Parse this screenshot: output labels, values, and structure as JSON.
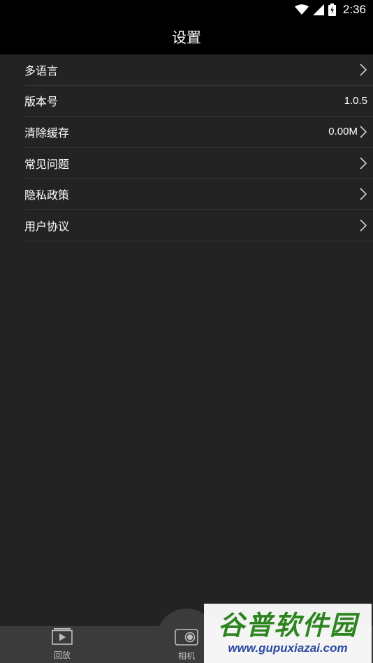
{
  "status_bar": {
    "time": "2:36",
    "icons": [
      "wifi-icon",
      "cell-signal-icon",
      "battery-charging-icon"
    ]
  },
  "header": {
    "title": "设置"
  },
  "settings": {
    "items": [
      {
        "label": "多语言",
        "value": "",
        "has_chevron": true
      },
      {
        "label": "版本号",
        "value": "1.0.5",
        "has_chevron": false
      },
      {
        "label": "清除缓存",
        "value": "0.00M",
        "has_chevron": true
      },
      {
        "label": "常见问题",
        "value": "",
        "has_chevron": true
      },
      {
        "label": "隐私政策",
        "value": "",
        "has_chevron": true
      },
      {
        "label": "用户协议",
        "value": "",
        "has_chevron": true
      }
    ]
  },
  "bottom_nav": {
    "playback_label": "回放",
    "camera_label": "相机"
  },
  "watermark": {
    "title": "谷普软件园",
    "url": "www.gupuxiazai.com"
  },
  "colors": {
    "background": "#232323",
    "bar": "#000000",
    "divider": "#343434",
    "nav": "#3b3b3b"
  }
}
